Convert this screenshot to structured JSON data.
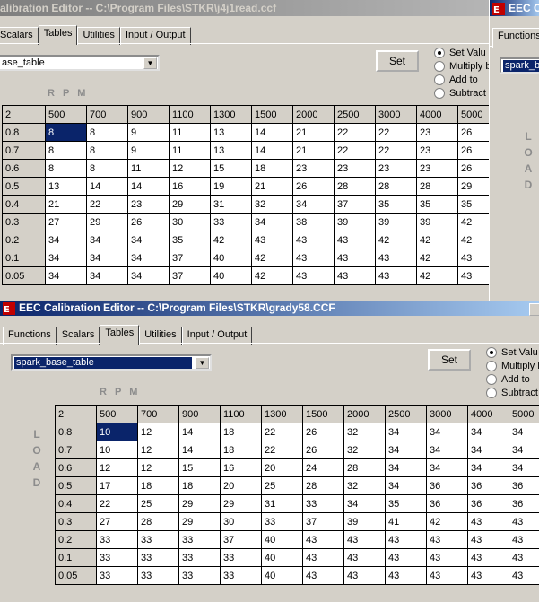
{
  "back_window": {
    "title": "alibration Editor -- C:\\Program Files\\STKR\\j4j1read.ccf",
    "tabs": [
      "Scalars",
      "Tables",
      "Utilities",
      "Input / Output"
    ],
    "selected_tab": "Tables",
    "table_select": "ase_table",
    "set_label": "Set",
    "options": [
      "Set Valu",
      "Multiply b",
      "Add to",
      "Subtract"
    ],
    "rpm_label": "R P M",
    "load_label": [
      "L",
      "O",
      "A",
      "D"
    ],
    "header": [
      "2",
      "500",
      "700",
      "900",
      "1100",
      "1300",
      "1500",
      "2000",
      "2500",
      "3000",
      "4000",
      "5000"
    ],
    "rows": [
      [
        "0.8",
        "8",
        "8",
        "9",
        "11",
        "13",
        "14",
        "21",
        "22",
        "22",
        "23",
        "26"
      ],
      [
        "0.7",
        "8",
        "8",
        "9",
        "11",
        "13",
        "14",
        "21",
        "22",
        "22",
        "23",
        "26"
      ],
      [
        "0.6",
        "8",
        "8",
        "11",
        "12",
        "15",
        "18",
        "23",
        "23",
        "23",
        "23",
        "26"
      ],
      [
        "0.5",
        "13",
        "14",
        "14",
        "16",
        "19",
        "21",
        "26",
        "28",
        "28",
        "28",
        "29"
      ],
      [
        "0.4",
        "21",
        "22",
        "23",
        "29",
        "31",
        "32",
        "34",
        "37",
        "35",
        "35",
        "35"
      ],
      [
        "0.3",
        "27",
        "29",
        "26",
        "30",
        "33",
        "34",
        "38",
        "39",
        "39",
        "39",
        "42"
      ],
      [
        "0.2",
        "34",
        "34",
        "34",
        "35",
        "42",
        "43",
        "43",
        "43",
        "42",
        "42",
        "42"
      ],
      [
        "0.1",
        "34",
        "34",
        "34",
        "37",
        "40",
        "42",
        "43",
        "43",
        "43",
        "42",
        "43"
      ],
      [
        "0.05",
        "34",
        "34",
        "34",
        "37",
        "40",
        "42",
        "43",
        "43",
        "43",
        "42",
        "43"
      ]
    ]
  },
  "right_window": {
    "title": "EEC C",
    "tab": "Functions",
    "table_select": "spark_ba"
  },
  "front_window": {
    "title": "EEC Calibration Editor -- C:\\Program Files\\STKR\\grady58.CCF",
    "tabs": [
      "Functions",
      "Scalars",
      "Tables",
      "Utilities",
      "Input / Output"
    ],
    "selected_tab": "Tables",
    "table_select": "spark_base_table",
    "set_label": "Set",
    "options": [
      "Set Valu",
      "Multiply b",
      "Add to",
      "Subtract"
    ],
    "rpm_label": "R P M",
    "load_label": [
      "L",
      "O",
      "A",
      "D"
    ],
    "header": [
      "2",
      "500",
      "700",
      "900",
      "1100",
      "1300",
      "1500",
      "2000",
      "2500",
      "3000",
      "4000",
      "5000"
    ],
    "rows": [
      [
        "0.8",
        "10",
        "12",
        "14",
        "18",
        "22",
        "26",
        "32",
        "34",
        "34",
        "34",
        "34"
      ],
      [
        "0.7",
        "10",
        "12",
        "14",
        "18",
        "22",
        "26",
        "32",
        "34",
        "34",
        "34",
        "34"
      ],
      [
        "0.6",
        "12",
        "12",
        "15",
        "16",
        "20",
        "24",
        "28",
        "34",
        "34",
        "34",
        "34"
      ],
      [
        "0.5",
        "17",
        "18",
        "18",
        "20",
        "25",
        "28",
        "32",
        "34",
        "36",
        "36",
        "36"
      ],
      [
        "0.4",
        "22",
        "25",
        "29",
        "29",
        "31",
        "33",
        "34",
        "35",
        "36",
        "36",
        "36"
      ],
      [
        "0.3",
        "27",
        "28",
        "29",
        "30",
        "33",
        "37",
        "39",
        "41",
        "42",
        "43",
        "43"
      ],
      [
        "0.2",
        "33",
        "33",
        "33",
        "37",
        "40",
        "43",
        "43",
        "43",
        "43",
        "43",
        "43"
      ],
      [
        "0.1",
        "33",
        "33",
        "33",
        "33",
        "40",
        "43",
        "43",
        "43",
        "43",
        "43",
        "43"
      ],
      [
        "0.05",
        "33",
        "33",
        "33",
        "33",
        "40",
        "43",
        "43",
        "43",
        "43",
        "43",
        "43"
      ]
    ]
  }
}
